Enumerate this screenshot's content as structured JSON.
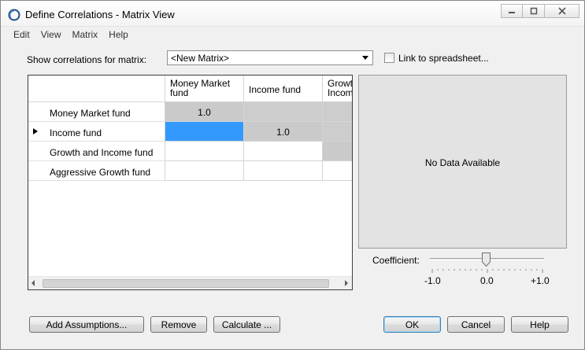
{
  "window": {
    "title": "Define Correlations - Matrix View",
    "controls": [
      "minimize",
      "maximize",
      "close"
    ]
  },
  "menu": [
    "Edit",
    "View",
    "Matrix",
    "Help"
  ],
  "matrix_selector": {
    "label": "Show correlations for matrix:",
    "selected": "<New Matrix>"
  },
  "link_checkbox": {
    "label": "Link to spreadsheet...",
    "checked": false
  },
  "grid": {
    "columns": [
      "Money Market fund",
      "Income fund",
      "Growth and Income fund"
    ],
    "rows": [
      {
        "label": "Money Market fund",
        "cells": [
          "1.0",
          "",
          ""
        ]
      },
      {
        "label": "Income fund",
        "cells": [
          "",
          "1.0",
          ""
        ]
      },
      {
        "label": "Growth and Income fund",
        "cells": [
          "",
          "",
          ""
        ]
      },
      {
        "label": "Aggressive Growth fund",
        "cells": [
          "",
          "",
          ""
        ]
      }
    ],
    "current_row": 1,
    "selected_cell": {
      "row": 1,
      "col": 0
    }
  },
  "preview": {
    "message": "No Data Available"
  },
  "coefficient": {
    "label": "Coefficient:",
    "value": 0.0,
    "min_label": "-1.0",
    "mid_label": "0.0",
    "max_label": "+1.0"
  },
  "buttons": {
    "add_assumptions": "Add Assumptions...",
    "remove": "Remove",
    "calculate": "Calculate ...",
    "ok": "OK",
    "cancel": "Cancel",
    "help": "Help"
  }
}
